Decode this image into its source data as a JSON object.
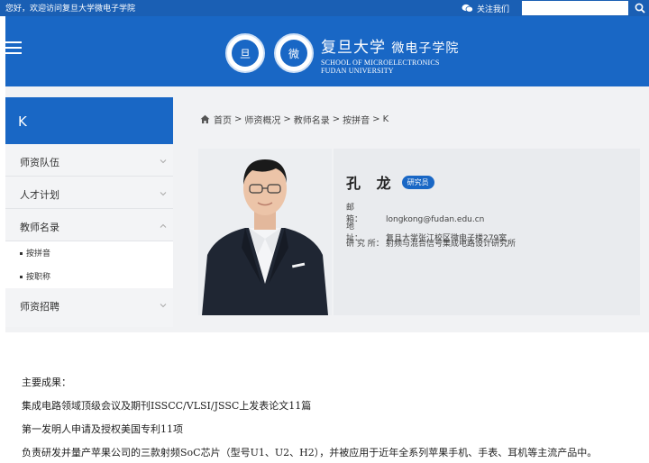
{
  "topbar": {
    "welcome": "您好，欢迎访问复旦大学微电子学院",
    "follow_label": "关注我们",
    "search_value": "",
    "icons": {
      "wechat": "wechat-icon",
      "search": "search-icon"
    }
  },
  "header": {
    "brand_cn": "复旦大学",
    "brand_sub": "微电子学院",
    "brand_en_1": "SCHOOL OF MICROELECTRONICS",
    "brand_en_2": "FUDAN UNIVERSITY",
    "emblem_1_char": "旦",
    "emblem_2_char": "微",
    "colors": {
      "brand_blue": "#1967c5",
      "topbar_blue": "#1a5fb4"
    }
  },
  "sidebar": {
    "title": "K",
    "items": [
      {
        "label": "师资队伍"
      },
      {
        "label": "人才计划"
      },
      {
        "label": "教师名录"
      }
    ],
    "subitems": [
      {
        "label": "按拼音"
      },
      {
        "label": "按职称"
      }
    ],
    "last_item": {
      "label": "师资招聘"
    }
  },
  "breadcrumb": {
    "items": [
      "首页",
      "师资概况",
      "教师名录",
      "按拼音",
      "K"
    ],
    "separator": ">"
  },
  "profile": {
    "name": "孔 龙",
    "badge": "研究员",
    "email_label": "邮　　箱：",
    "email": "longkong@fudan.edu.cn",
    "address_label": "地　　址：",
    "address": "复旦大学张江校区微电子楼279室",
    "field_label": "研 究 所：",
    "field": "射频与混合信号集成电路设计研究所"
  },
  "achievements": {
    "heading": "主要成果：",
    "lines": [
      "集成电路领域顶级会议及期刊ISSCC/VLSI/JSSC上发表论文11篇",
      "第一发明人申请及授权美国专利11项",
      "负责研发并量产苹果公司的三款射频SoC芯片（型号U1、U2、H2），并被应用于近年全系列苹果手机、手表、耳机等主流产品中。"
    ]
  }
}
